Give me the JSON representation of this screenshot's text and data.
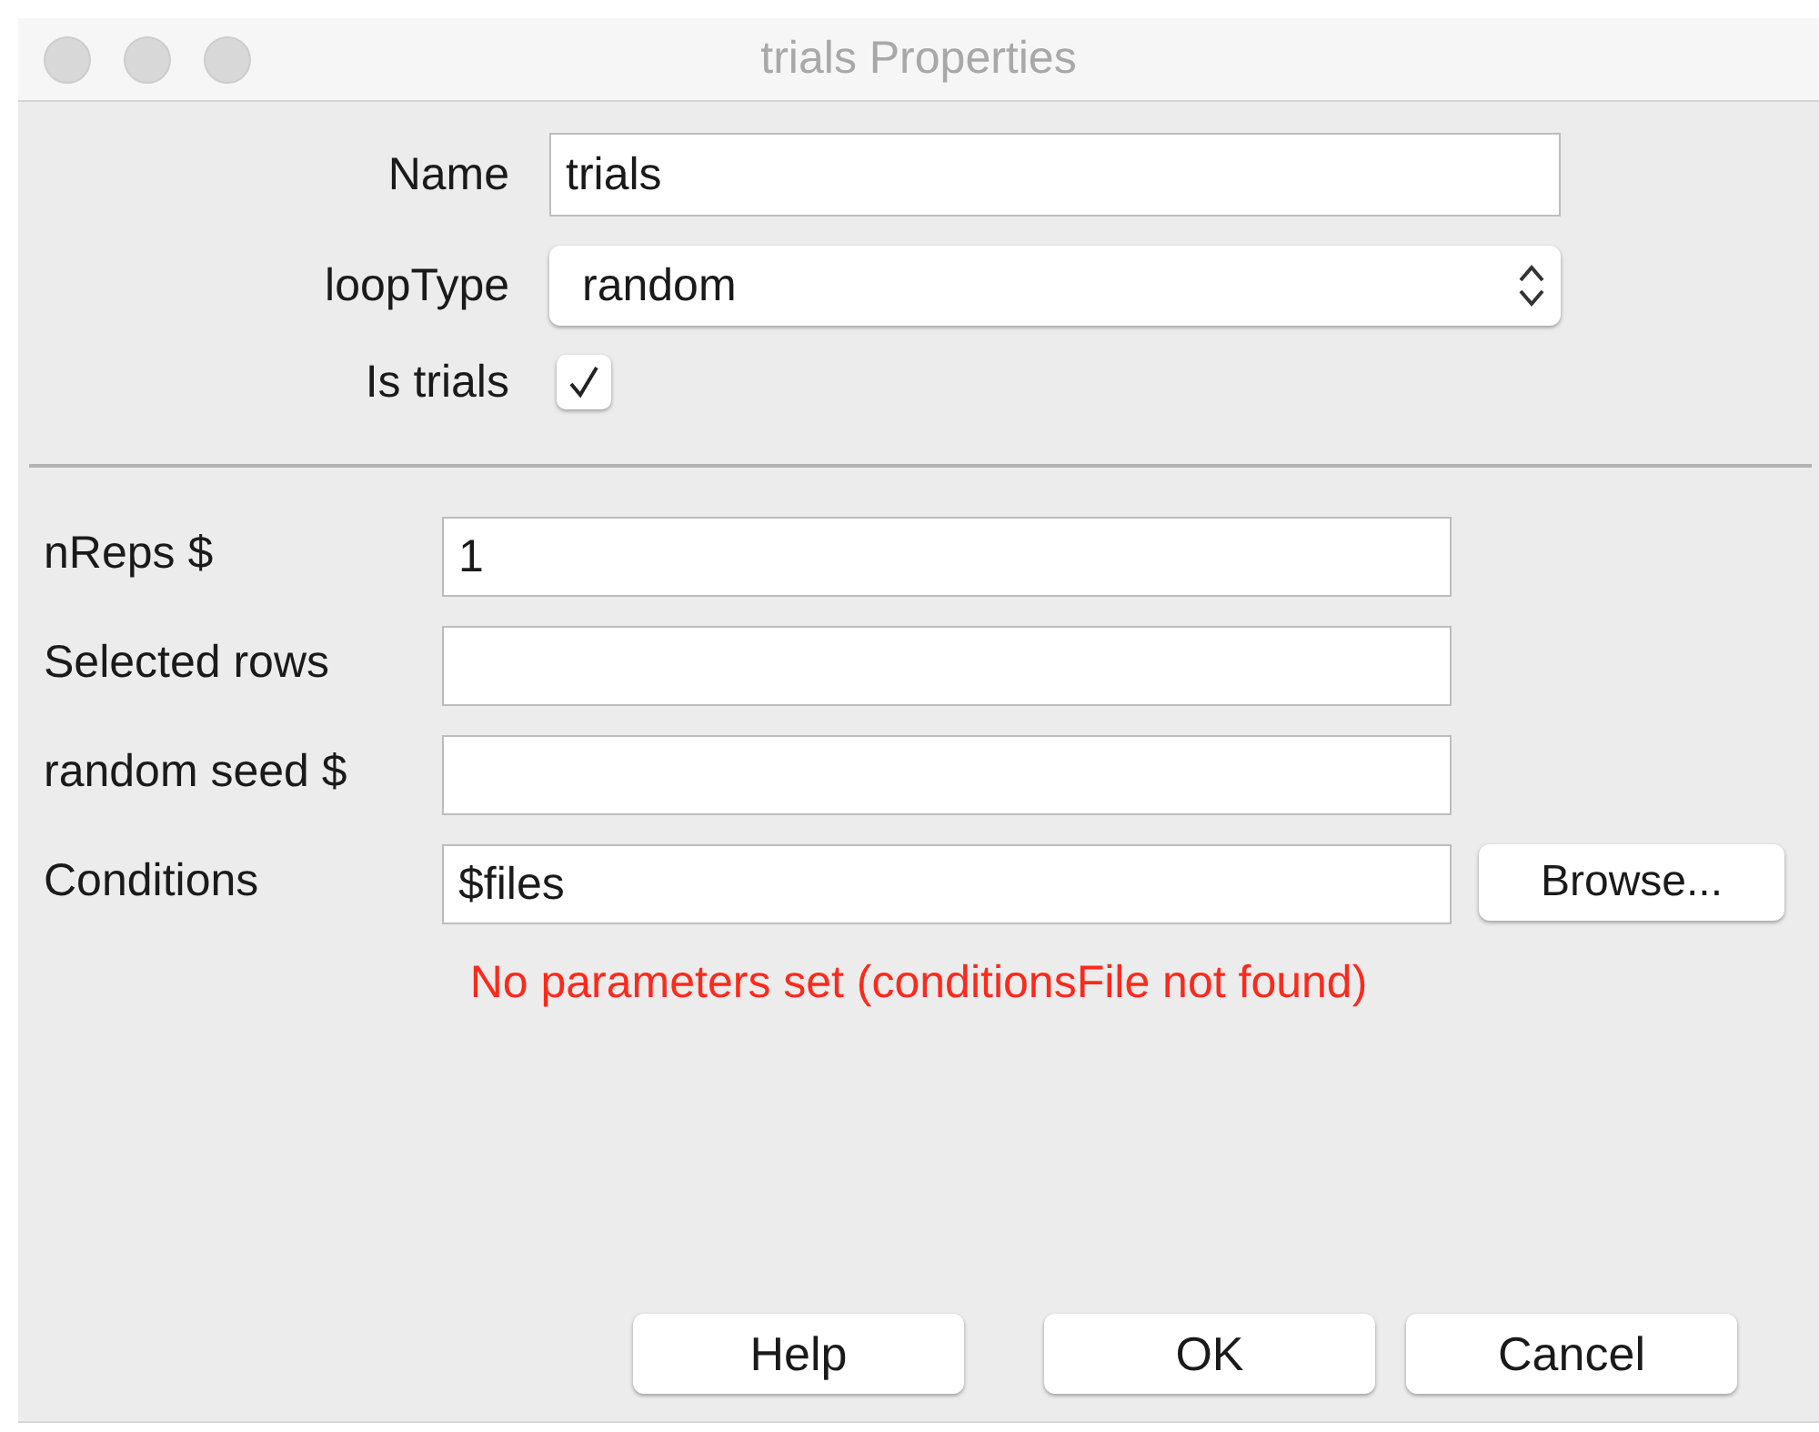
{
  "window": {
    "title": "trials Properties"
  },
  "top_fields": [
    {
      "kind": "text",
      "label": "Name",
      "value": "trials"
    },
    {
      "kind": "select",
      "label": "loopType",
      "value": "random"
    },
    {
      "kind": "checkbox",
      "label": "Is trials",
      "checked": true
    }
  ],
  "fields": [
    {
      "label": "nReps $",
      "value": "1"
    },
    {
      "label": "Selected rows"
    },
    {
      "label": "random seed $"
    },
    {
      "label": "Conditions",
      "value": "$files",
      "button": "Browse..."
    }
  ],
  "error": "No parameters set (conditionsFile not found)",
  "buttons": [
    "Help",
    "OK",
    "Cancel"
  ]
}
